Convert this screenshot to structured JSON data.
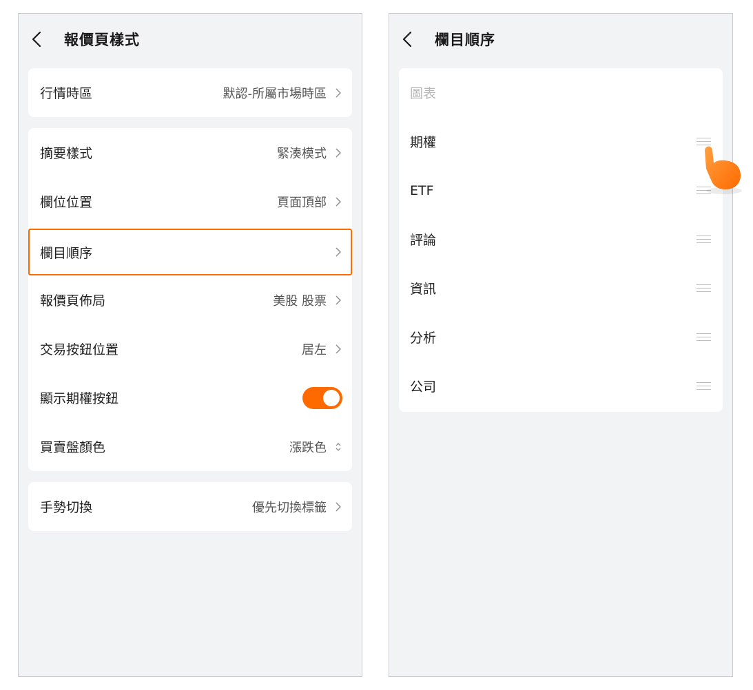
{
  "left": {
    "title": "報價頁樣式",
    "market_timezone": {
      "label": "行情時區",
      "value": "默認-所屬市場時區"
    },
    "settings": [
      {
        "label": "摘要樣式",
        "value": "緊湊模式"
      },
      {
        "label": "欄位位置",
        "value": "頁面頂部"
      },
      {
        "label": "欄目順序",
        "value": ""
      },
      {
        "label": "報價頁佈局",
        "value": "美股 股票"
      },
      {
        "label": "交易按鈕位置",
        "value": "居左"
      },
      {
        "label": "顯示期權按鈕",
        "toggle_on": true
      },
      {
        "label": "買賣盤顏色",
        "value": "漲跌色"
      }
    ],
    "gesture": {
      "label": "手勢切換",
      "value": "優先切換標籤"
    }
  },
  "right": {
    "title": "欄目順序",
    "items": [
      {
        "label": "圖表",
        "disabled": true
      },
      {
        "label": "期權"
      },
      {
        "label": "ETF"
      },
      {
        "label": "評論"
      },
      {
        "label": "資訊"
      },
      {
        "label": "分析"
      },
      {
        "label": "公司"
      }
    ]
  },
  "colors": {
    "accent": "#ff6a00",
    "background": "#f2f3f5",
    "card": "#ffffff"
  }
}
